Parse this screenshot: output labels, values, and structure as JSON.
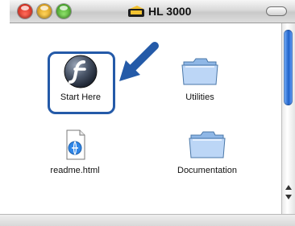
{
  "window": {
    "title": "HL 3000",
    "brand_icon_text": "brother"
  },
  "items": [
    {
      "label": "Start Here",
      "icon": "flash-icon"
    },
    {
      "label": "Utilities",
      "icon": "folder-icon"
    },
    {
      "label": "readme.html",
      "icon": "html-document-icon"
    },
    {
      "label": "Documentation",
      "icon": "folder-icon"
    }
  ],
  "colors": {
    "highlight_frame": "#245aa8",
    "callout_arrow": "#245aa8",
    "scroll_thumb": "#1f62c9"
  }
}
